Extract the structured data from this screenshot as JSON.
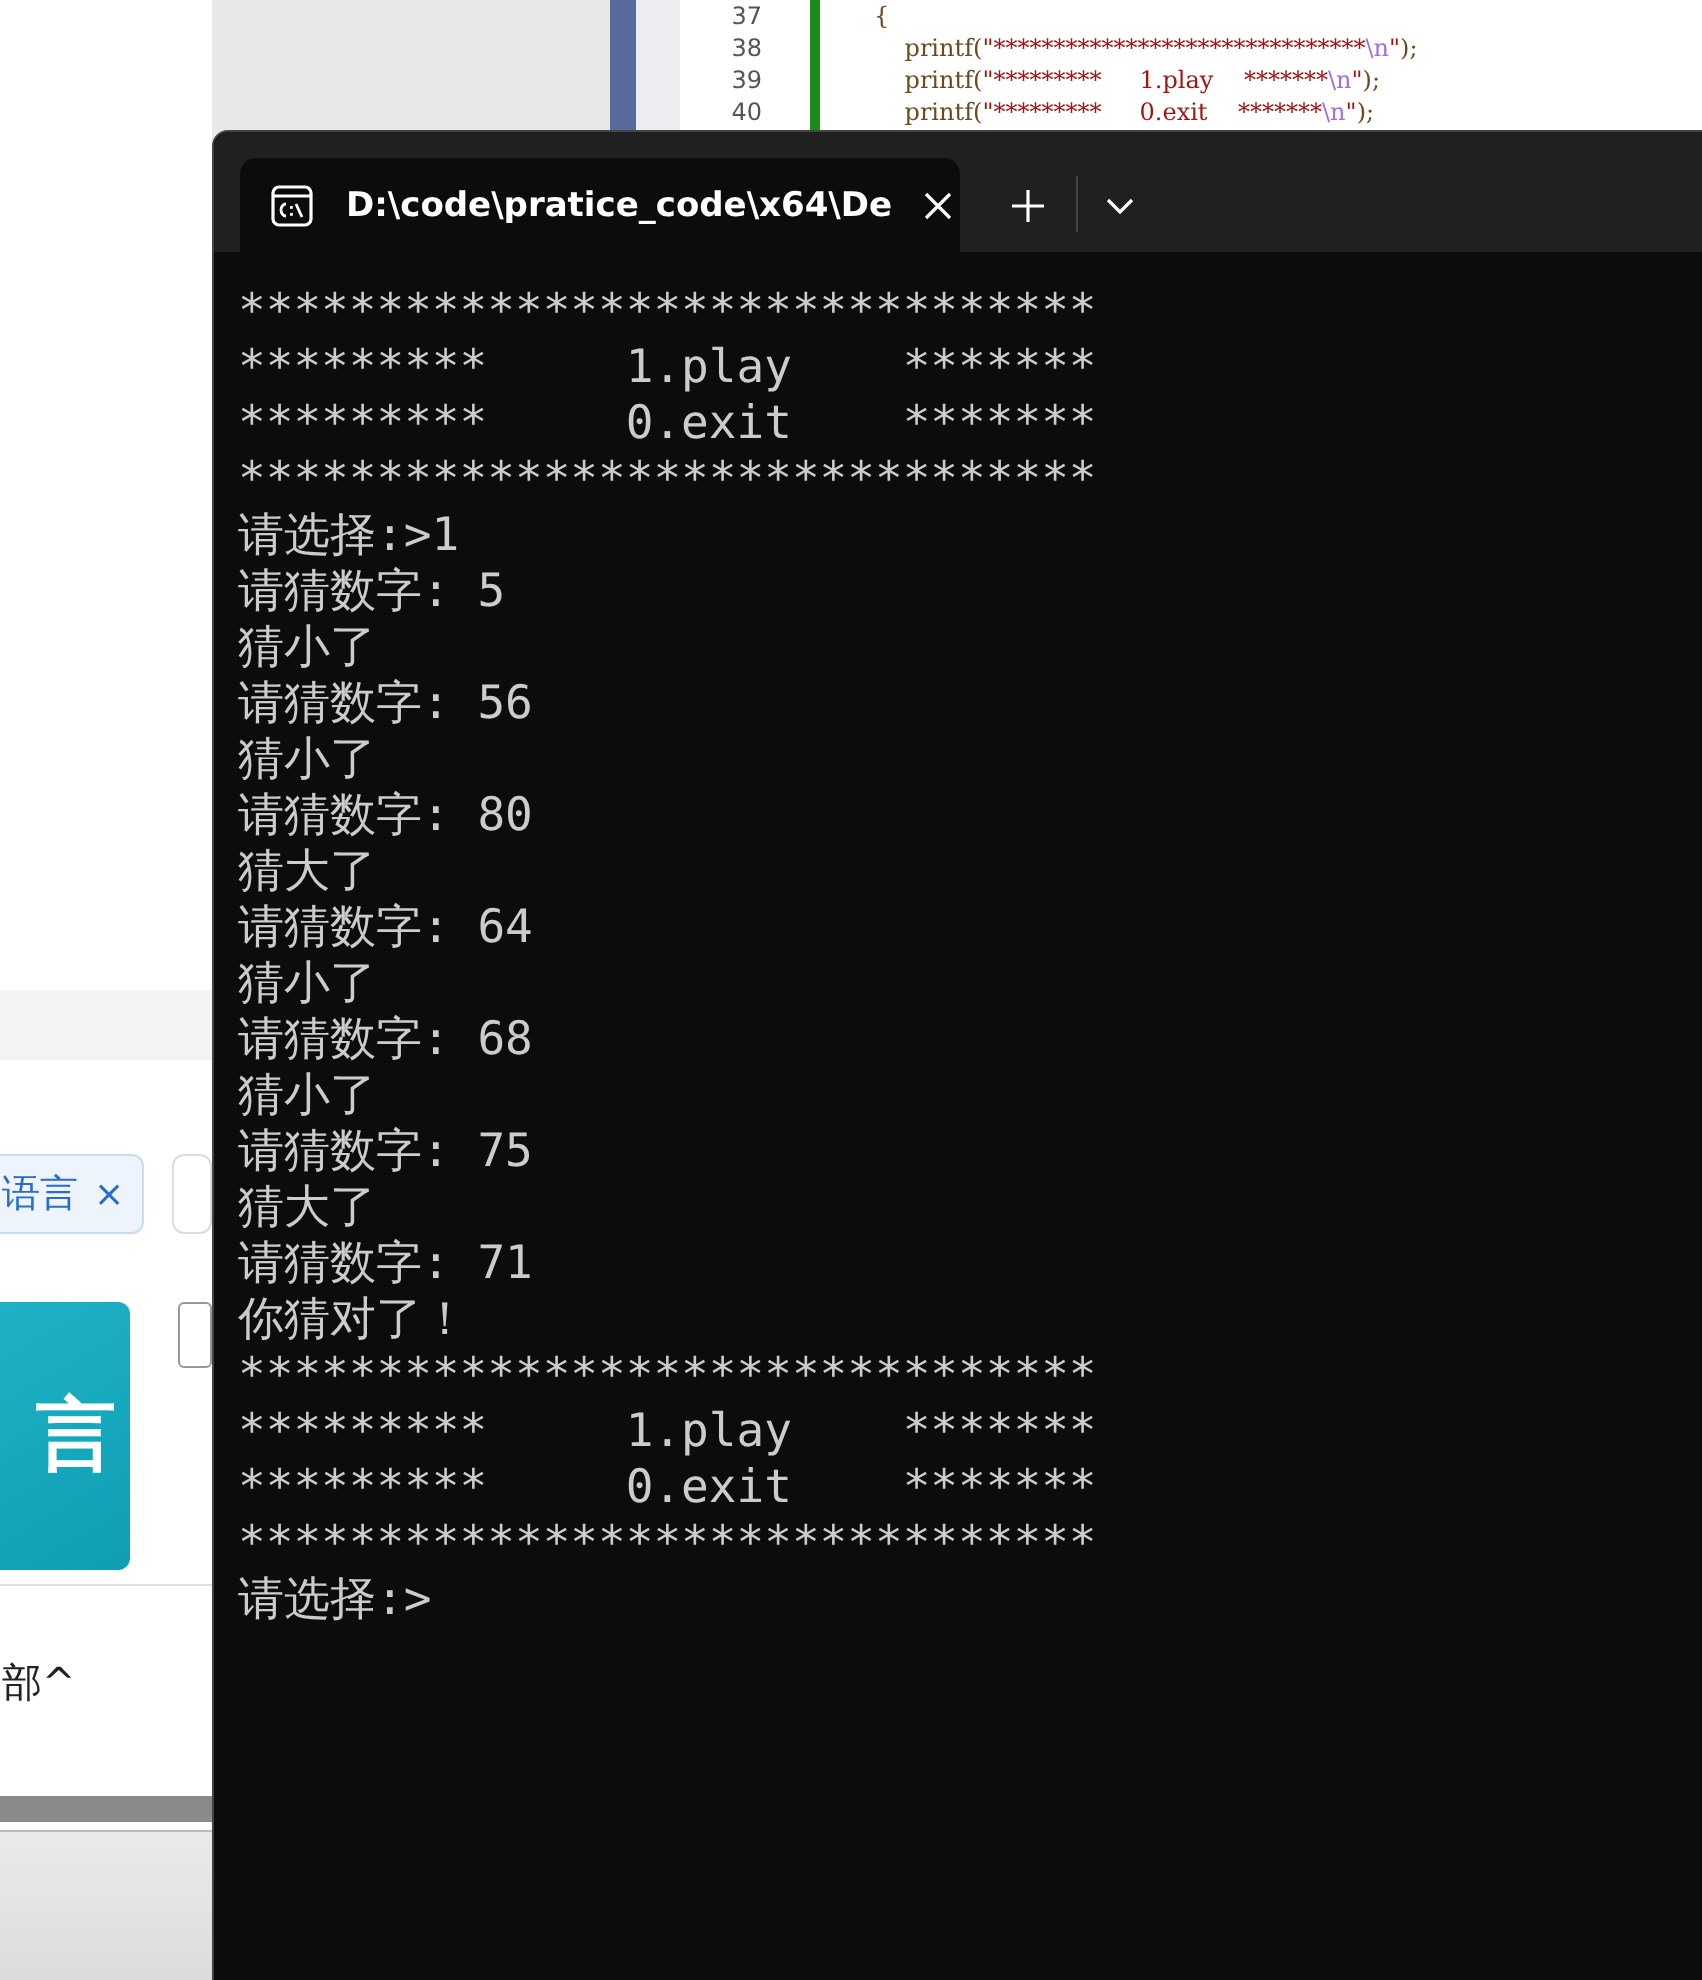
{
  "editor": {
    "lines": [
      {
        "number": "37",
        "tokens": [
          {
            "kind": "plain",
            "text": "{"
          }
        ]
      },
      {
        "number": "38",
        "tokens": [
          {
            "kind": "plain",
            "text": "    printf("
          },
          {
            "kind": "string",
            "text": "\"*******************************"
          },
          {
            "kind": "escape",
            "text": "\\n"
          },
          {
            "kind": "string",
            "text": "\""
          },
          {
            "kind": "plain",
            "text": ");"
          }
        ]
      },
      {
        "number": "39",
        "tokens": [
          {
            "kind": "plain",
            "text": "    printf("
          },
          {
            "kind": "string",
            "text": "\"*********     1.play    *******"
          },
          {
            "kind": "escape",
            "text": "\\n"
          },
          {
            "kind": "string",
            "text": "\""
          },
          {
            "kind": "plain",
            "text": ");"
          }
        ]
      },
      {
        "number": "40",
        "tokens": [
          {
            "kind": "plain",
            "text": "    printf("
          },
          {
            "kind": "string",
            "text": "\"*********     0.exit    *******"
          },
          {
            "kind": "escape",
            "text": "\\n"
          },
          {
            "kind": "string",
            "text": "\""
          },
          {
            "kind": "plain",
            "text": ");"
          }
        ]
      }
    ]
  },
  "browser": {
    "tag": {
      "label": "语言",
      "close": "×"
    },
    "tile": "言",
    "toggle": "部^"
  },
  "terminal": {
    "tab": {
      "title": "D:\\code\\pratice_code\\x64\\De",
      "selected": true
    },
    "lines": [
      "*******************************",
      "*********     1.play    *******",
      "*********     0.exit    *******",
      "*******************************",
      "请选择:>1",
      "请猜数字: 5",
      "猜小了",
      "请猜数字: 56",
      "猜小了",
      "请猜数字: 80",
      "猜大了",
      "请猜数字: 64",
      "猜小了",
      "请猜数字: 68",
      "猜小了",
      "请猜数字: 75",
      "猜大了",
      "请猜数字: 71",
      "你猜对了！",
      "*******************************",
      "*********     1.play    *******",
      "*********     0.exit    *******",
      "*******************************",
      "请选择:>"
    ]
  }
}
